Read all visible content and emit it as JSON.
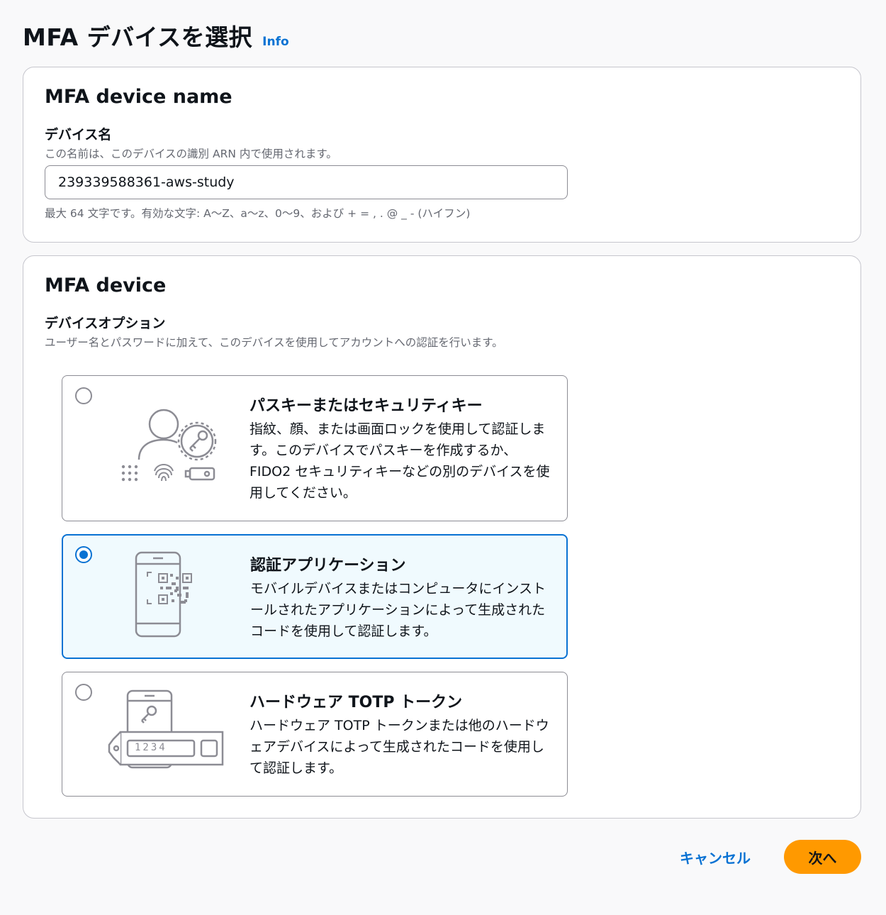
{
  "page": {
    "title": "MFA デバイスを選択",
    "info_link": "Info"
  },
  "device_name_section": {
    "heading": "MFA device name",
    "label": "デバイス名",
    "description": "この名前は、このデバイスの識別 ARN 内で使用されます。",
    "input_value": "239339588361-aws-study",
    "constraint": "最大 64 文字です。有効な文字: A〜Z、a〜z、0〜9、および + = , . @ _ - (ハイフン)"
  },
  "device_section": {
    "heading": "MFA device",
    "label": "デバイスオプション",
    "description": "ユーザー名とパスワードに加えて、このデバイスを使用してアカウントへの認証を行います。",
    "options": [
      {
        "title": "パスキーまたはセキュリティキー",
        "description": "指紋、顔、または画面ロックを使用して認証します。このデバイスでパスキーを作成するか、FIDO2 セキュリティキーなどの別のデバイスを使用してください。",
        "selected": false,
        "icon": "passkey-icon"
      },
      {
        "title": "認証アプリケーション",
        "description": "モバイルデバイスまたはコンピュータにインストールされたアプリケーションによって生成されたコードを使用して認証します。",
        "selected": true,
        "icon": "authenticator-app-icon"
      },
      {
        "title": "ハードウェア TOTP トークン",
        "description": "ハードウェア TOTP トークンまたは他のハードウェアデバイスによって生成されたコードを使用して認証します。",
        "selected": false,
        "icon": "hardware-token-icon",
        "token_display": "1234"
      }
    ]
  },
  "actions": {
    "cancel_label": "キャンセル",
    "next_label": "次へ"
  },
  "colors": {
    "accent": "#0972d3",
    "primary_button": "#ff9900",
    "selected_background": "#f0fafe",
    "border": "#c6c6cd"
  }
}
